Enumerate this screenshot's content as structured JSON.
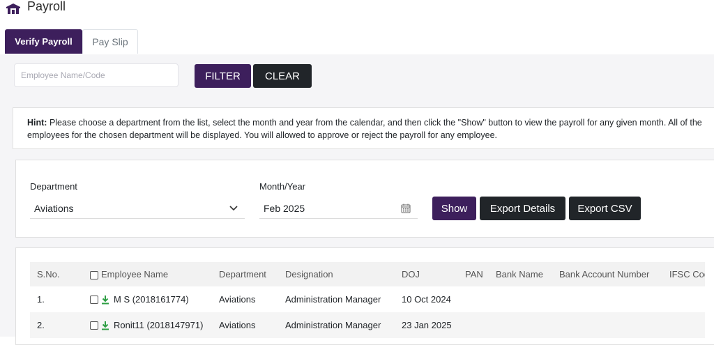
{
  "page": {
    "title": "Payroll"
  },
  "tabs": [
    {
      "label": "Verify Payroll",
      "active": true
    },
    {
      "label": "Pay Slip",
      "active": false
    }
  ],
  "filter": {
    "search_placeholder": "Employee Name/Code",
    "search_value": "",
    "filter_label": "FILTER",
    "clear_label": "CLEAR"
  },
  "hint": {
    "label": "Hint:",
    "text": " Please choose a department from the list, select the month and year from the calendar, and then click the \"Show\" button to view the payroll for any given month. All of the employees for the chosen department will be displayed. You will allowed to approve or reject the payroll for any employee."
  },
  "controls": {
    "department_label": "Department",
    "department_value": "Aviations",
    "month_label": "Month/Year",
    "month_value": "Feb 2025",
    "show_label": "Show",
    "export_details_label": "Export Details",
    "export_csv_label": "Export CSV"
  },
  "table": {
    "headers": [
      "S.No.",
      "Employee Name",
      "Department",
      "Designation",
      "DOJ",
      "PAN",
      "Bank Name",
      "Bank Account Number",
      "IFSC Code"
    ],
    "rows": [
      {
        "sno": "1.",
        "name": "M S (2018161774)",
        "department": "Aviations",
        "designation": "Administration Manager",
        "doj": "10 Oct 2024",
        "pan": "",
        "bank": "",
        "account": "",
        "ifsc": ""
      },
      {
        "sno": "2.",
        "name": "Ronit11 (2018147971)",
        "department": "Aviations",
        "designation": "Administration Manager",
        "doj": "23 Jan 2025",
        "pan": "",
        "bank": "",
        "account": "",
        "ifsc": ""
      }
    ]
  },
  "icons": {
    "title": "home-icon",
    "download": "download-icon",
    "calendar": "calendar-icon",
    "select": "chevron-down-icon"
  },
  "colors": {
    "primary": "#3d1f5c",
    "dark": "#212529",
    "download": "#2e9e44"
  }
}
